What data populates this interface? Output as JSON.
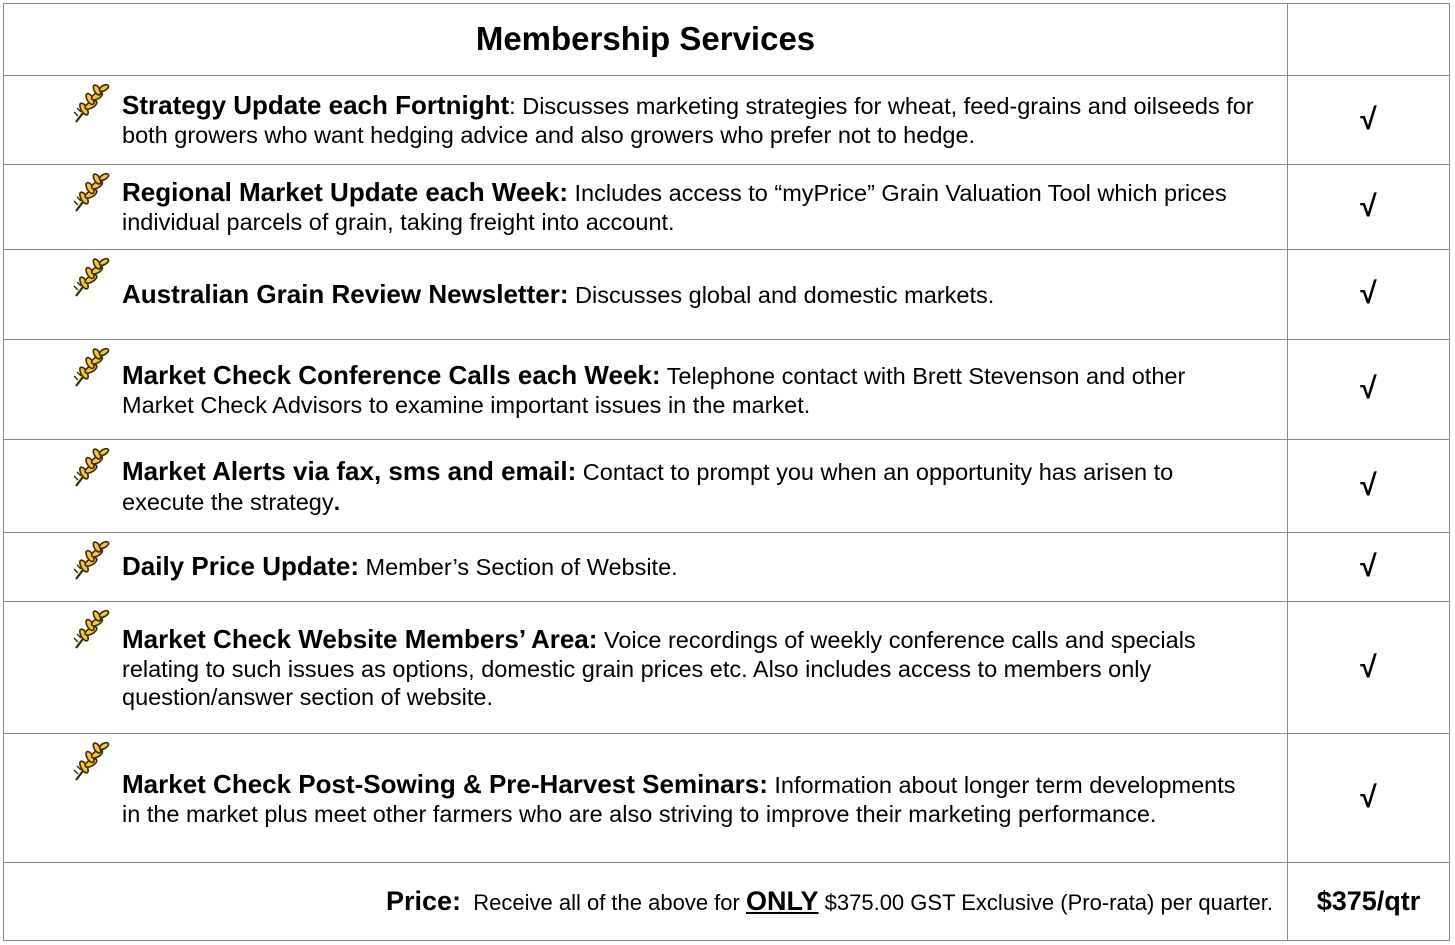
{
  "title": "Membership Services",
  "tick_symbol": "√",
  "icon": "wheat-icon",
  "accent_colors": {
    "wheat_fill": "#f5c542",
    "wheat_outline": "#3a2a00"
  },
  "services": [
    {
      "title": "Strategy Update each Fortnight",
      "sep": ": ",
      "body": "Discusses marketing strategies for wheat, feed-grains and oilseeds for both growers who want hedging advice and also growers who prefer not to hedge.",
      "tail": ""
    },
    {
      "title": "Regional Market Update each Week:",
      "sep": " ",
      "body": "Includes access to “myPrice” Grain Valuation Tool which prices individual parcels of grain, taking freight into account.",
      "tail": ""
    },
    {
      "title": "Australian Grain Review Newsletter:",
      "sep": " ",
      "body": "Discusses global and domestic markets.",
      "tail": ""
    },
    {
      "title": "Market Check Conference Calls each Week:",
      "sep": " ",
      "body": "Telephone contact with Brett Stevenson and other Market Check Advisors to examine important issues in the market.",
      "tail": ""
    },
    {
      "title": "Market Alerts via fax, sms and email:",
      "sep": " ",
      "body": "Contact to prompt you when an opportunity has arisen to execute the strategy",
      "tail": "."
    },
    {
      "title": "Daily Price Update:",
      "sep": " ",
      "body": "Member’s Section of Website.",
      "tail": ""
    },
    {
      "title": "Market Check Website Members’ Area:",
      "sep": " ",
      "body": "Voice recordings of weekly conference calls and specials relating to such issues as options, domestic grain prices etc. Also includes access to members only question/answer section of website.",
      "tail": ""
    },
    {
      "title": "Market Check Post-Sowing & Pre-Harvest Seminars:",
      "sep": " ",
      "body": "Information about longer term developments in the market plus meet other farmers who are also striving to improve their marketing performance.",
      "tail": ""
    }
  ],
  "price": {
    "label": "Price:",
    "text_before": "Receive all of the above for",
    "only": "ONLY",
    "text_after": "$375.00 GST Exclusive (Pro-rata) per quarter.",
    "amount": "$375/qtr"
  }
}
